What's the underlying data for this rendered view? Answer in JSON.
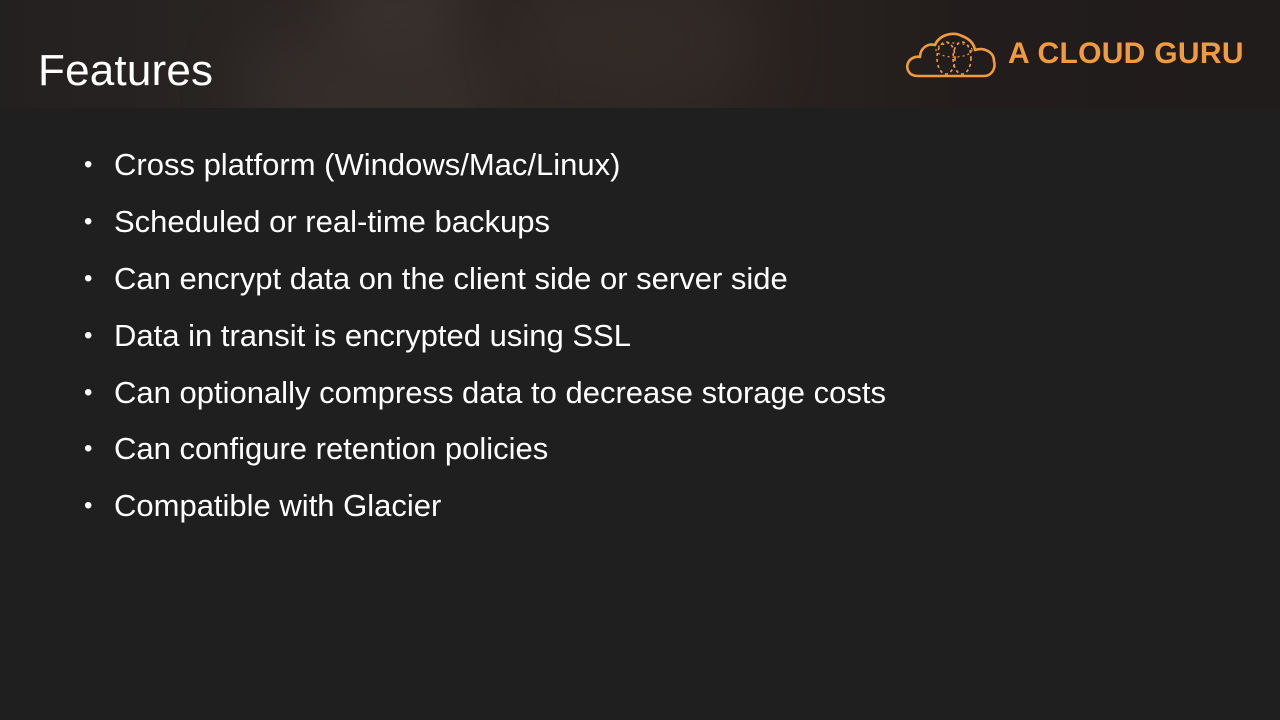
{
  "slide": {
    "title": "Features",
    "logo": {
      "text": "A CLOUD GURU",
      "icon": "cloud-icon",
      "color": "#f29a3e"
    },
    "bullet_glyph": "•",
    "bullets": [
      "Cross platform (Windows/Mac/Linux)",
      "Scheduled or real-time backups",
      "Can encrypt data on the client side or server side",
      "Data in transit is encrypted using SSL",
      "Can optionally compress data to decrease storage costs",
      "Can configure retention policies",
      "Compatible with Glacier"
    ]
  },
  "colors": {
    "background": "#1f1f1f",
    "text": "#ffffff",
    "accent": "#f29a3e"
  }
}
